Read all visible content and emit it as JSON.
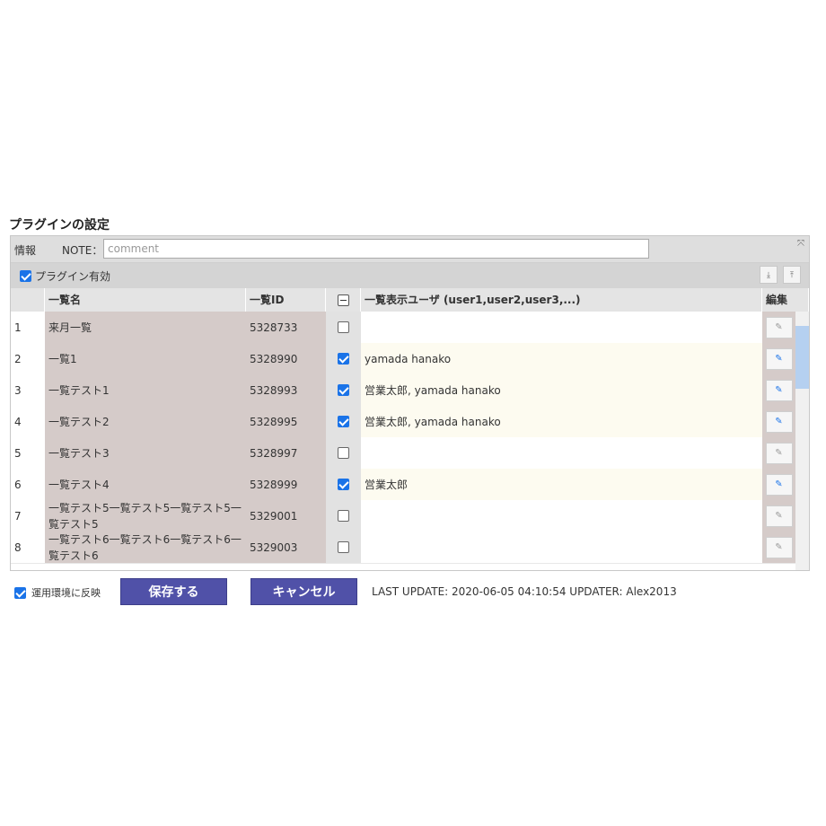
{
  "title": "プラグインの設定",
  "info": {
    "label": "情報",
    "note_label": "NOTE：",
    "note_value": "",
    "note_placeholder": "comment"
  },
  "plugin_enabled": {
    "label": "プラグイン有効",
    "checked": true
  },
  "headers": {
    "name": "一覧名",
    "id": "一覧ID",
    "users": "一覧表示ユーザ (user1,user2,user3,...)",
    "edit": "編集"
  },
  "rows": [
    {
      "num": "1",
      "name": "来月一覧",
      "id": "5328733",
      "checked": false,
      "users": ""
    },
    {
      "num": "2",
      "name": "一覧1",
      "id": "5328990",
      "checked": true,
      "users": "yamada hanako"
    },
    {
      "num": "3",
      "name": "一覧テスト1",
      "id": "5328993",
      "checked": true,
      "users": "営業太郎, yamada hanako"
    },
    {
      "num": "4",
      "name": "一覧テスト2",
      "id": "5328995",
      "checked": true,
      "users": "営業太郎, yamada hanako"
    },
    {
      "num": "5",
      "name": "一覧テスト3",
      "id": "5328997",
      "checked": false,
      "users": ""
    },
    {
      "num": "6",
      "name": "一覧テスト4",
      "id": "5328999",
      "checked": true,
      "users": "営業太郎"
    },
    {
      "num": "7",
      "name": "一覧テスト5一覧テスト5一覧テスト5一覧テスト5",
      "id": "5329001",
      "checked": false,
      "users": ""
    },
    {
      "num": "8",
      "name": "一覧テスト6一覧テスト6一覧テスト6一覧テスト6",
      "id": "5329003",
      "checked": false,
      "users": ""
    }
  ],
  "footer": {
    "apply_label": "運用環境に反映",
    "apply_checked": true,
    "save_label": "保存する",
    "cancel_label": "キャンセル",
    "last_update": "LAST UPDATE: 2020-06-05 04:10:54 UPDATER: Alex2013"
  },
  "colors": {
    "accent": "#1a73e8",
    "button": "#5051a8",
    "name_cell": "#d5cbc9",
    "checked_row": "#fdfbf0"
  }
}
